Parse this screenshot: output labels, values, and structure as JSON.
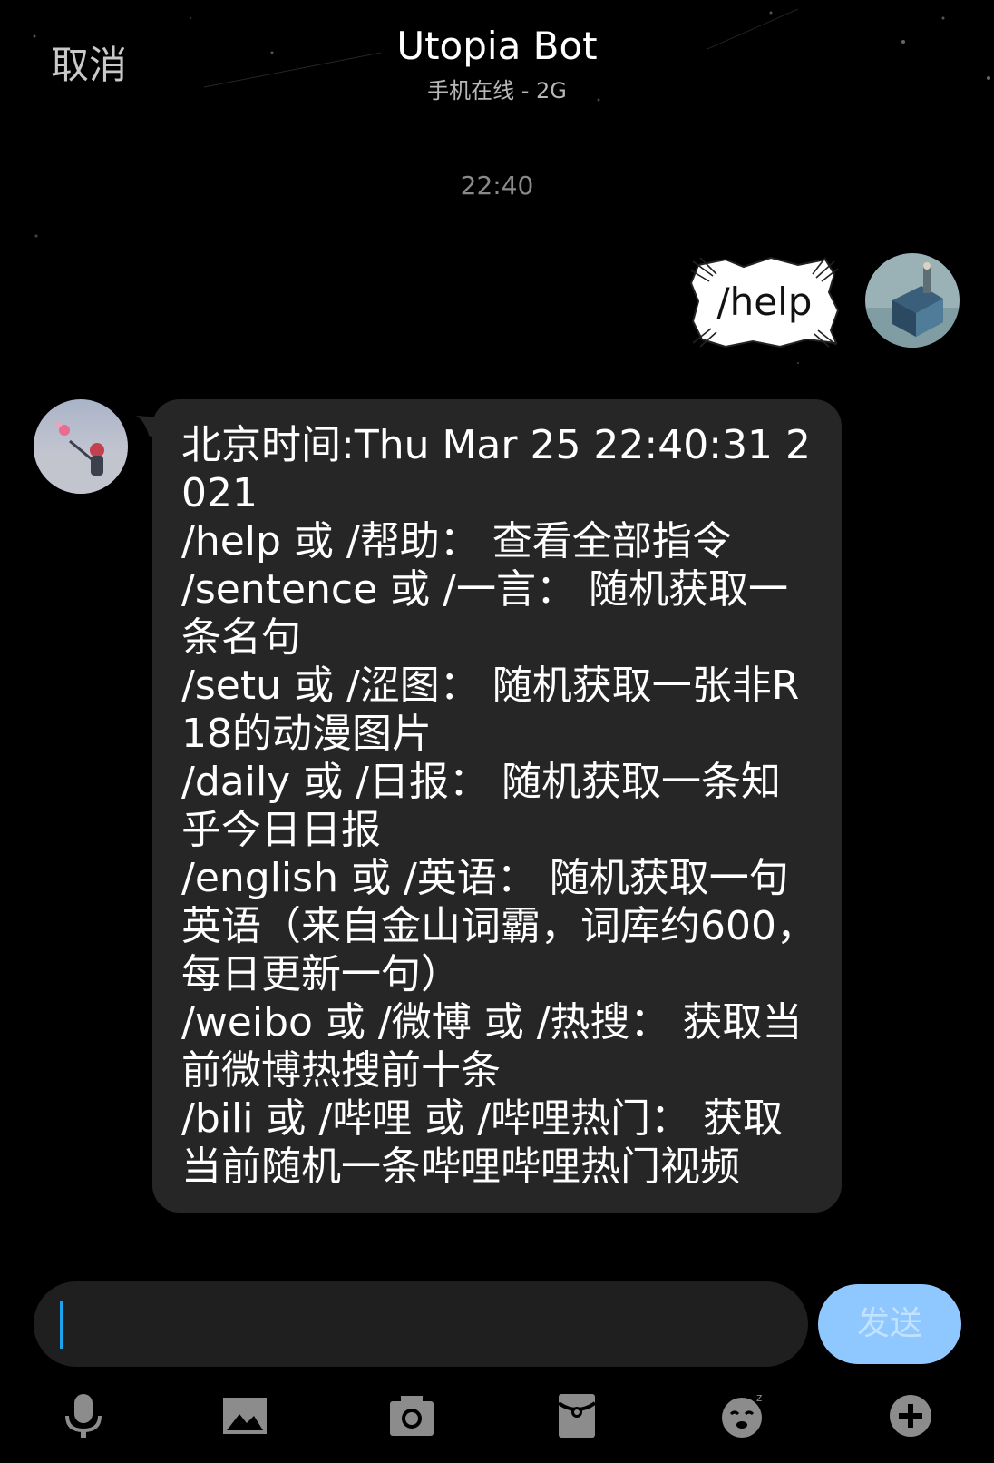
{
  "header": {
    "cancel_label": "取消",
    "title": "Utopia Bot",
    "subtitle": "手机在线 - 2G"
  },
  "chat": {
    "timestamp": "22:40",
    "messages": [
      {
        "sender": "me",
        "text": "/help"
      },
      {
        "sender": "bot",
        "text": "北京时间:Thu Mar 25 22:40:31 2021\n/help 或 /帮助： 查看全部指令\n/sentence 或 /一言： 随机获取一条名句\n/setu 或 /涩图： 随机获取一张非R18的动漫图片\n/daily 或 /日报： 随机获取一条知乎今日日报\n/english 或 /英语： 随机获取一句英语（来自金山词霸，词库约600，每日更新一句）\n/weibo 或 /微博 或 /热搜： 获取当前微博热搜前十条\n/bili 或 /哔哩 或 /哔哩热门： 获取当前随机一条哔哩哔哩热门视频"
      }
    ]
  },
  "composer": {
    "input_value": "",
    "send_label": "发送"
  },
  "toolbar": {
    "icons": [
      "microphone-icon",
      "image-icon",
      "camera-icon",
      "red-envelope-icon",
      "emoji-icon",
      "plus-icon"
    ]
  },
  "colors": {
    "background": "#000000",
    "bubble": "#262626",
    "send_button": "#8fc7ff",
    "cursor": "#1ba3f0"
  }
}
